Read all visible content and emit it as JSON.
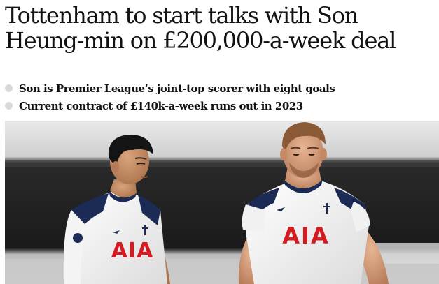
{
  "article": {
    "headline_line1": "Tottenham to start talks with Son",
    "headline_line2": "Heung-min on £200,000-a-week deal",
    "standfirst": [
      "Son is Premier League’s joint-top scorer with eight goals",
      "Current contract of £140k-a-week runs out in 2023"
    ]
  },
  "photo": {
    "shirt_sponsor": "AIA",
    "colors": {
      "shirt": "#f3f3f1",
      "sleeve": "#1c2b55",
      "sponsor": "#d71920",
      "bullet_dot": "#d9d9d9"
    }
  }
}
